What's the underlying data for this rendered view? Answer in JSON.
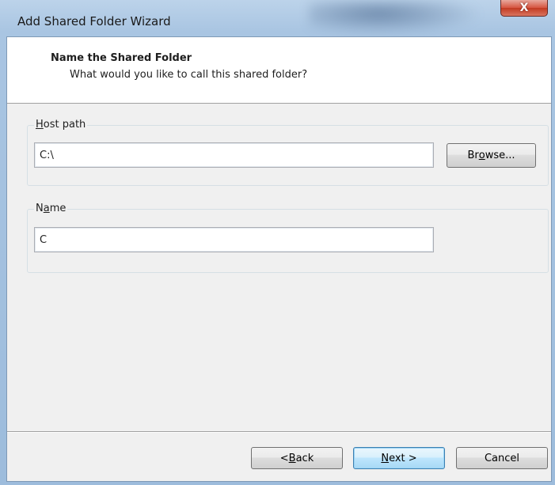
{
  "window": {
    "title": "Add Shared Folder Wizard",
    "close_symbol": "X"
  },
  "header": {
    "title": "Name the Shared Folder",
    "subtitle": "What would you like to call this shared folder?"
  },
  "host_path": {
    "label_prefix": "",
    "label_mnemonic": "H",
    "label_rest": "ost path",
    "value": "C:\\",
    "browse_pre": "Br",
    "browse_mnemonic": "o",
    "browse_post": "wse..."
  },
  "name": {
    "label_prefix": "N",
    "label_mnemonic": "a",
    "label_rest": "me",
    "value": "C"
  },
  "footer": {
    "back_pre": "< ",
    "back_mnemonic": "B",
    "back_post": "ack",
    "next_mnemonic": "N",
    "next_post": "ext >",
    "cancel_label": "Cancel"
  }
}
